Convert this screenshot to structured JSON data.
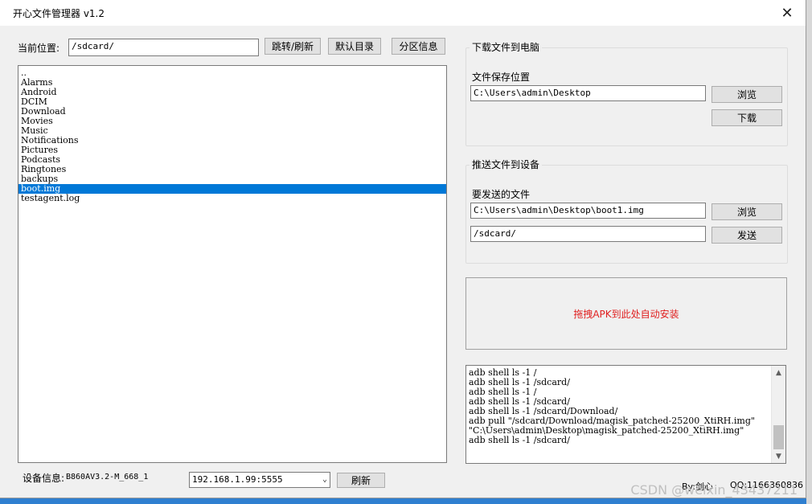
{
  "window": {
    "title": "开心文件管理器  v1.2",
    "close_icon": "✕"
  },
  "location": {
    "label": "当前位置:",
    "value": "/sdcard/",
    "buttons": {
      "jump": "跳转/刷新",
      "default_dir": "默认目录",
      "partition": "分区信息"
    }
  },
  "files": {
    "items": [
      "..",
      "Alarms",
      "Android",
      "DCIM",
      "Download",
      "Movies",
      "Music",
      "Notifications",
      "Pictures",
      "Podcasts",
      "Ringtones",
      "backups",
      "boot.img",
      "testagent.log"
    ],
    "selected": "boot.img"
  },
  "download": {
    "group_title": "下载文件到电脑",
    "save_label": "文件保存位置",
    "save_path": "C:\\Users\\admin\\Desktop",
    "browse": "浏览",
    "download_btn": "下载"
  },
  "push": {
    "group_title": "推送文件到设备",
    "file_label": "要发送的文件",
    "file_path": "C:\\Users\\admin\\Desktop\\boot1.img",
    "browse": "浏览",
    "target": "/sdcard/",
    "send_btn": "发送"
  },
  "drop_zone": {
    "text": "拖拽APK到此处自动安装",
    "color": "#e02020"
  },
  "log": {
    "lines": [
      "adb shell  ls -1  /",
      "adb shell  ls -1  /sdcard/",
      "adb shell  ls -1  /",
      "adb shell  ls -1  /sdcard/",
      "adb shell  ls -1  /sdcard/Download/",
      "adb pull \"/sdcard/Download/magisk_patched-25200_XtiRH.img\"",
      "\"C:\\Users\\admin\\Desktop\\magisk_patched-25200_XtiRH.img\"",
      "adb shell  ls -1  /sdcard/"
    ]
  },
  "footer": {
    "device_label": "设备信息:",
    "device_value": "B860AV3.2-M_668_1",
    "address": "192.168.1.99:5555",
    "refresh": "刷新",
    "author": "By:剑心",
    "qq": "QQ:1166360836"
  },
  "watermark": "CSDN @weixin_43437211",
  "colors": {
    "selection": "#0078d7",
    "window_bg": "#f0f0f0"
  }
}
